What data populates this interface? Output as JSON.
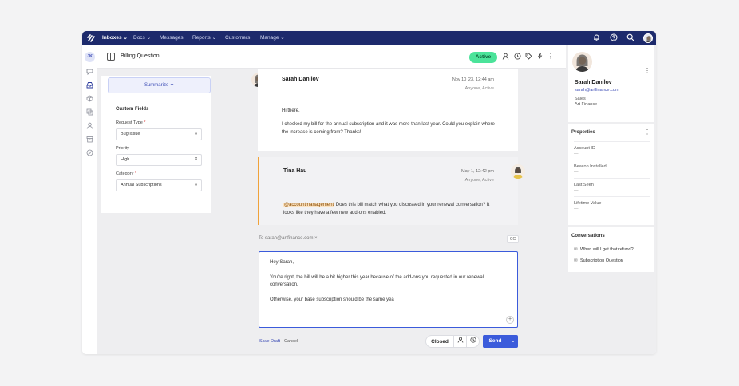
{
  "nav": {
    "items": [
      {
        "label": "Inboxes ⌄",
        "active": true
      },
      {
        "label": "Docs ⌄",
        "active": false
      },
      {
        "label": "Messages",
        "active": false
      },
      {
        "label": "Reports ⌄",
        "active": false
      },
      {
        "label": "Customers",
        "active": false
      },
      {
        "label": "Manage ⌄",
        "active": false
      }
    ]
  },
  "ticket": {
    "title": "Billing Question",
    "status": "Active"
  },
  "summarize": {
    "label": "Summarize ✦"
  },
  "custom_fields": {
    "title": "Custom Fields",
    "fields": [
      {
        "label": "Request Type",
        "value": "Bug/Issue"
      },
      {
        "label": "Priority",
        "value": "High"
      },
      {
        "label": "Category",
        "value": "Annual Subscriptions"
      }
    ]
  },
  "messages": [
    {
      "author": "Sarah Danilov",
      "time": "Nov 10 '23, 12:44 am",
      "sub": "Anyone, Active",
      "lines": [
        "Hi there,",
        "I checked my bill for the annual subscription and it was more than last year. Could you explain where",
        "the increase is coming from? Thanks!"
      ]
    },
    {
      "author": "Tina Hau",
      "time": "May 1, 12:42 pm",
      "sub": "Anyone, Active",
      "dash": "——",
      "mention": "@accountmanagement",
      "line1": " Does this bill match what you discussed in your renewal conversation? It",
      "line2": "looks like they have a few new add-ons enabled."
    }
  ],
  "composer": {
    "to": "To  sarah@artfinance.com  ×",
    "cc": "CC",
    "greeting": "Hey Sarah,",
    "para1a": "You're right, the bill will be a bit higher this year because of the add-ons you requested in our renewal",
    "para1b": "conversation.",
    "para2": "Otherwise, your base subscription should be the same yea",
    "ellipsis": "...",
    "plus": "+"
  },
  "footer": {
    "save_draft": "Save Draft",
    "cancel": "Cancel",
    "closed": "Closed",
    "send": "Send"
  },
  "contact": {
    "name": "Sarah Danilov",
    "email": "sarah@artfinance.com",
    "role": "Sales",
    "company": "Art Finance"
  },
  "properties": {
    "title": "Properties",
    "items": [
      {
        "label": "Account ID",
        "value": "—"
      },
      {
        "label": "Beacon Installed",
        "value": "—"
      },
      {
        "label": "Last Seen",
        "value": "—"
      },
      {
        "label": "Lifetime Value",
        "value": "—"
      }
    ]
  },
  "conversations": {
    "title": "Conversations",
    "items": [
      "When will I get that refund?",
      "Subscription Question"
    ]
  },
  "user_initials": "JK",
  "colors": {
    "nav_bg": "#1d2a6c",
    "accent": "#3b5bdb",
    "status_active": "#4be39a",
    "note_border": "#f0a23a"
  }
}
